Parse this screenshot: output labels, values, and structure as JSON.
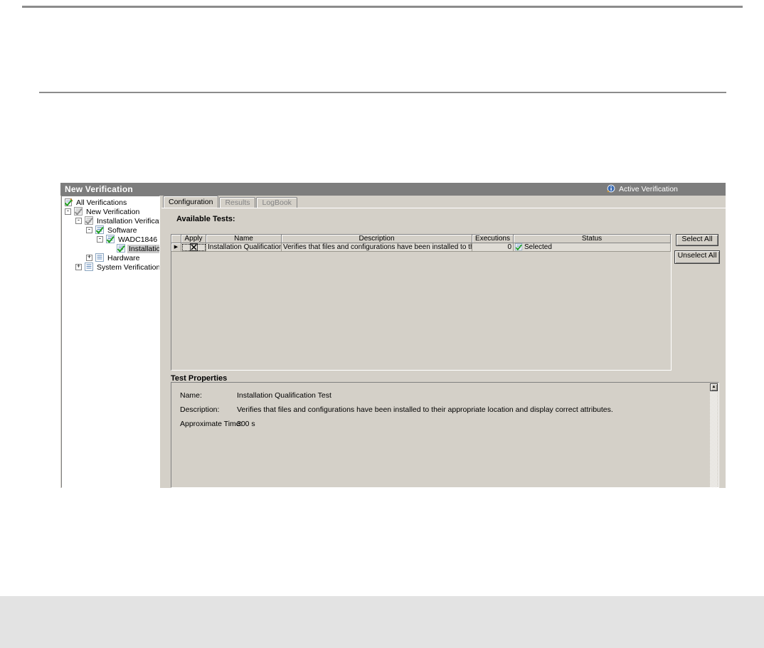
{
  "window": {
    "title": "New Verification",
    "active_label": "Active Verification",
    "titlebar_bg": "#7d7d7d",
    "chrome_bg": "#d4d0c8"
  },
  "tree": {
    "items": [
      {
        "label": "All Verifications",
        "icon": "verifications-root",
        "expander": "",
        "selected": false
      },
      {
        "label": "New Verification",
        "icon": "check-gray",
        "expander": "-",
        "selected": false
      },
      {
        "label": "Installation Verification",
        "icon": "check-gray",
        "expander": "-",
        "selected": false
      },
      {
        "label": "Software",
        "icon": "check-green",
        "expander": "-",
        "selected": false
      },
      {
        "label": "WADC1846",
        "icon": "check-green",
        "expander": "-",
        "selected": false
      },
      {
        "label": "Installation",
        "icon": "check-green",
        "expander": "",
        "selected": true
      },
      {
        "label": "Hardware",
        "icon": "doc-lines",
        "expander": "+",
        "selected": false
      },
      {
        "label": "System Verification",
        "icon": "doc-lines",
        "expander": "+",
        "selected": false
      }
    ]
  },
  "tabs": [
    {
      "label": "Configuration",
      "state": "active"
    },
    {
      "label": "Results",
      "state": "disabled"
    },
    {
      "label": "LogBook",
      "state": "disabled"
    }
  ],
  "available_tests": {
    "heading": "Available Tests:",
    "columns": [
      "Apply",
      "Name",
      "Description",
      "Executions",
      "Status"
    ],
    "rows": [
      {
        "apply": "checked",
        "name": "Installation Qualification...",
        "description": "Verifies that files and configurations have been installed to their ap...",
        "executions": "0",
        "status": "Selected"
      }
    ],
    "buttons": {
      "select_all": "Select All",
      "unselect_all": "Unselect All"
    }
  },
  "test_properties": {
    "heading": "Test Properties",
    "fields": [
      {
        "label": "Name:",
        "value": "Installation Qualification Test"
      },
      {
        "label": "Description:",
        "value": "Verifies that files and configurations have been installed to their appropriate location and display correct attributes."
      },
      {
        "label": "Approximate Time:",
        "value": "300 s"
      }
    ]
  },
  "icons": {
    "row_arrow": "▶",
    "scroll_up": "▲"
  },
  "colors": {
    "check_green": "#21a121",
    "icon_blue": "#5a84b8",
    "selection_gray": "#c9c9c9",
    "rule_gray": "#8c8c8c",
    "bottom_band": "#e3e3e3"
  }
}
